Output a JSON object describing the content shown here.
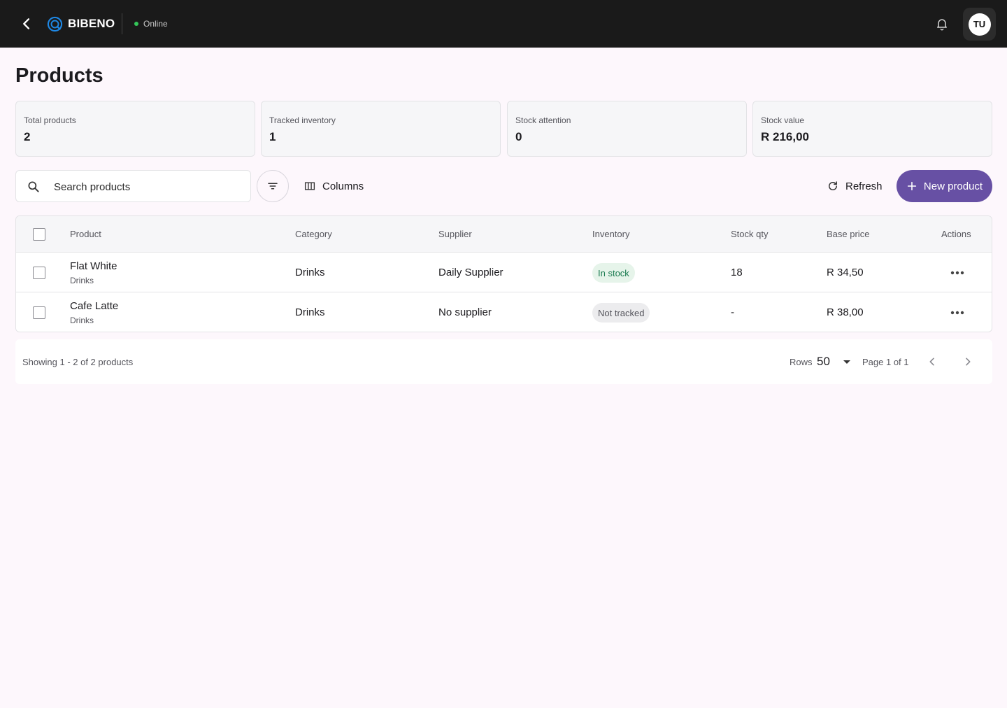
{
  "topbar": {
    "brand": "BIBENO",
    "status": "Online",
    "avatar_initials": "TU",
    "accent": "#1e88e5",
    "status_color": "#34c759"
  },
  "page": {
    "title": "Products"
  },
  "stats": [
    {
      "label": "Total products",
      "value": "2"
    },
    {
      "label": "Tracked inventory",
      "value": "1"
    },
    {
      "label": "Stock attention",
      "value": "0"
    },
    {
      "label": "Stock value",
      "value": "R 216,00"
    }
  ],
  "toolbar": {
    "search_placeholder": "Search products",
    "columns_label": "Columns",
    "refresh_label": "Refresh",
    "new_label": "New product",
    "primary_color": "#6750a4"
  },
  "table": {
    "headers": {
      "product": "Product",
      "category": "Category",
      "supplier": "Supplier",
      "inventory": "Inventory",
      "stock_qty": "Stock qty",
      "base_price": "Base price",
      "actions": "Actions"
    },
    "rows": [
      {
        "name": "Flat White",
        "sub": "Drinks",
        "category": "Drinks",
        "supplier": "Daily Supplier",
        "inventory": "In stock",
        "inventory_status": "green",
        "stock_qty": "18",
        "base_price": "R 34,50"
      },
      {
        "name": "Cafe Latte",
        "sub": "Drinks",
        "category": "Drinks",
        "supplier": "No supplier",
        "inventory": "Not tracked",
        "inventory_status": "grey",
        "stock_qty": "-",
        "base_price": "R 38,00"
      }
    ]
  },
  "pagination": {
    "summary": "Showing 1 - 2 of 2 products",
    "rows_label": "Rows",
    "rows_value": "50",
    "page_text": "Page 1 of 1"
  }
}
